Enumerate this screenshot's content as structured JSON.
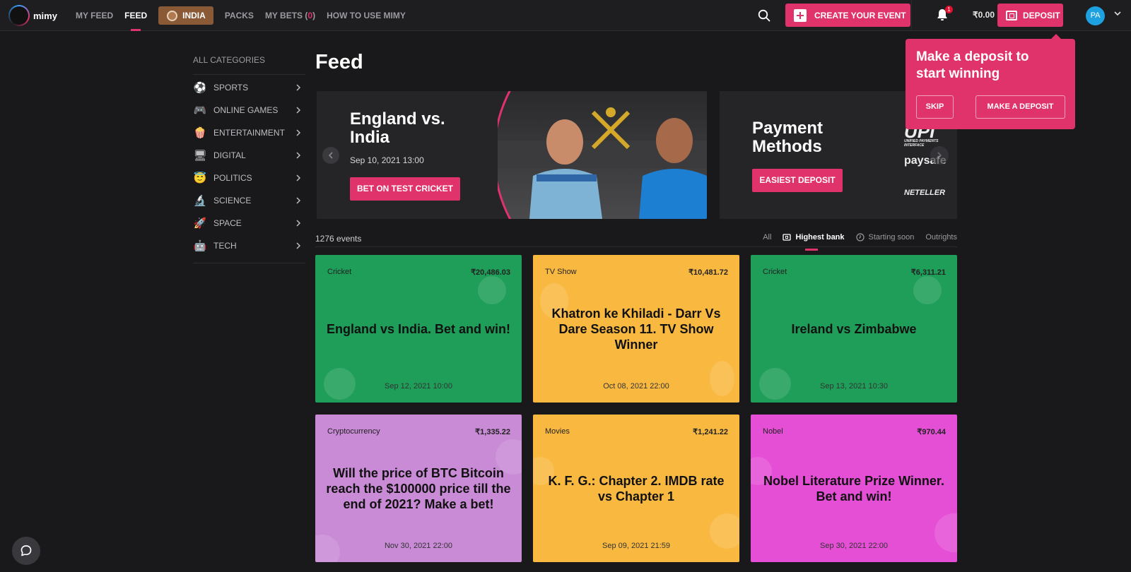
{
  "header": {
    "logo": "mimy",
    "nav": [
      {
        "label": "MY FEED",
        "active": false
      },
      {
        "label": "FEED",
        "active": true
      }
    ],
    "india_label": "INDIA",
    "packs_label": "PACKS",
    "mybets_label": "MY BETS (",
    "mybets_count": "0",
    "mybets_close": ")",
    "howto_label": "HOW TO USE MIMY",
    "create_event_label": "CREATE YOUR EVENT",
    "notifications_count": "1",
    "balance": "₹0.00",
    "deposit_label": "DEPOSIT",
    "avatar_initials": "PA"
  },
  "sidebar": {
    "title": "ALL CATEGORIES",
    "categories": [
      {
        "label": "SPORTS",
        "icon": "⚽"
      },
      {
        "label": "ONLINE GAMES",
        "icon": "🎮"
      },
      {
        "label": "ENTERTAINMENT",
        "icon": "🍿"
      },
      {
        "label": "DIGITAL",
        "icon": "🖥"
      },
      {
        "label": "POLITICS",
        "icon": "😇"
      },
      {
        "label": "SCIENCE",
        "icon": "🔬"
      },
      {
        "label": "SPACE",
        "icon": "🚀"
      },
      {
        "label": "TECH",
        "icon": "🤖"
      }
    ]
  },
  "main": {
    "title": "Feed",
    "banner1": {
      "title_line1": "England vs.",
      "title_line2": "India",
      "date": "Sep 10, 2021 13:00",
      "button": "BET ON TEST CRICKET"
    },
    "banner2": {
      "title_line1": "Payment",
      "title_line2": "Methods",
      "button": "EASIEST DEPOSIT",
      "logos": [
        "UPI",
        "UNIFIED PAYMENTS INTERFACE",
        "paysafe",
        "NETELLER"
      ]
    },
    "events_count": "1276 events",
    "filters": [
      {
        "label": "All",
        "active": false
      },
      {
        "label": "Highest bank",
        "active": true
      },
      {
        "label": "Starting soon",
        "active": false
      },
      {
        "label": "Outrights",
        "active": false
      }
    ],
    "cards": [
      {
        "category": "Cricket",
        "bank": "₹20,486.03",
        "title": "England vs India. Bet and win!",
        "date": "Sep 12, 2021 10:00",
        "color": "#1e9e58"
      },
      {
        "category": "TV Show",
        "bank": "₹10,481.72",
        "title": "Khatron ke Khiladi - Darr Vs Dare Season 11. TV Show Winner",
        "date": "Oct 08, 2021 22:00",
        "color": "#f9b941"
      },
      {
        "category": "Cricket",
        "bank": "₹6,311.21",
        "title": "Ireland vs Zimbabwe",
        "date": "Sep 13, 2021 10:30",
        "color": "#1e9e58"
      },
      {
        "category": "Cryptocurrency",
        "bank": "₹1,335.22",
        "title": "Will the price of BTC Bitcoin reach the $100000 price till the end of 2021? Make a bet!",
        "date": "Nov 30, 2021 22:00",
        "color": "#c98ad6"
      },
      {
        "category": "Movies",
        "bank": "₹1,241.22",
        "title": "K. F. G.: Chapter 2. IMDB rate vs Chapter 1",
        "date": "Sep 09, 2021 21:59",
        "color": "#f9b941"
      },
      {
        "category": "Nobel",
        "bank": "₹970.44",
        "title": "Nobel Literature Prize Winner. Bet and win!",
        "date": "Sep 30, 2021 22:00",
        "color": "#e54fd6"
      }
    ]
  },
  "popup": {
    "title_line1": "Make a deposit to",
    "title_line2": "start winning",
    "skip": "SKIP",
    "make_deposit": "MAKE A DEPOSIT"
  },
  "colors": {
    "accent": "#e0336b",
    "background": "#19191b",
    "india_badge": "#8a5a37",
    "avatar": "#1da1e0"
  }
}
